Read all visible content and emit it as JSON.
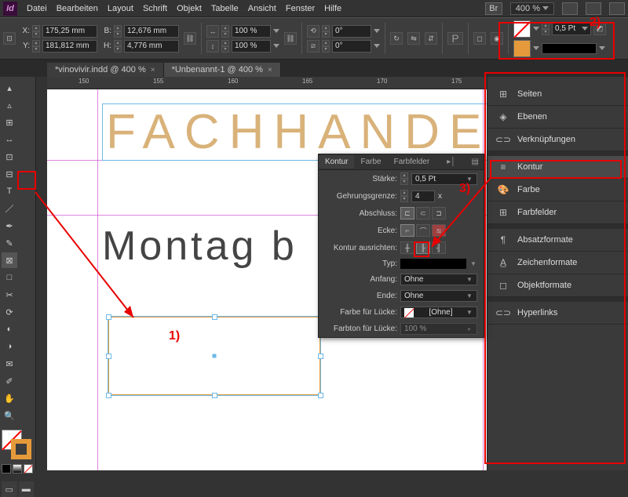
{
  "app": {
    "logo": "Id"
  },
  "menu": [
    "Datei",
    "Bearbeiten",
    "Layout",
    "Schrift",
    "Objekt",
    "Tabelle",
    "Ansicht",
    "Fenster",
    "Hilfe"
  ],
  "menu_right": {
    "br": "Br",
    "zoom": "400 %"
  },
  "control": {
    "x": "175,25 mm",
    "y": "181,812 mm",
    "w": "12,676 mm",
    "h": "4,776 mm",
    "sx": "100 %",
    "sy": "100 %",
    "rot": "0°",
    "shear": "0°",
    "stroke_weight": "0,5 Pt"
  },
  "tabs": [
    {
      "label": "*vinovivir.indd @ 400 %",
      "active": false
    },
    {
      "label": "*Unbenannt-1 @ 400 %",
      "active": true
    }
  ],
  "ruler_marks": [
    "150",
    "155",
    "160",
    "165",
    "170",
    "175"
  ],
  "canvas": {
    "heading": "FACHHANDE",
    "subheading": "Montag b"
  },
  "panels": {
    "items": [
      {
        "icon": "⊞",
        "label": "Seiten"
      },
      {
        "icon": "◈",
        "label": "Ebenen"
      },
      {
        "icon": "⊂⊃",
        "label": "Verknüpfungen"
      }
    ],
    "items2": [
      {
        "icon": "≡",
        "label": "Kontur",
        "active": true
      },
      {
        "icon": "🎨",
        "label": "Farbe"
      },
      {
        "icon": "⊞",
        "label": "Farbfelder"
      }
    ],
    "items3": [
      {
        "icon": "¶",
        "label": "Absatzformate"
      },
      {
        "icon": "A̲",
        "label": "Zeichenformate"
      },
      {
        "icon": "◻",
        "label": "Objektformate"
      }
    ],
    "items4": [
      {
        "icon": "⊂⊃",
        "label": "Hyperlinks"
      }
    ]
  },
  "stroke_panel": {
    "tabs": [
      "Kontur",
      "Farbe",
      "Farbfelder"
    ],
    "rows": {
      "staerke": {
        "label": "Stärke:",
        "value": "0,5 Pt"
      },
      "gehrung": {
        "label": "Gehrungsgrenze:",
        "value": "4",
        "suffix": "x"
      },
      "abschluss": {
        "label": "Abschluss:"
      },
      "ecke": {
        "label": "Ecke:"
      },
      "ausrichten": {
        "label": "Kontur ausrichten:"
      },
      "typ": {
        "label": "Typ:"
      },
      "anfang": {
        "label": "Anfang:",
        "value": "Ohne"
      },
      "ende": {
        "label": "Ende:",
        "value": "Ohne"
      },
      "farbe_luecke": {
        "label": "Farbe für Lücke:",
        "value": "[Ohne]"
      },
      "farbton_luecke": {
        "label": "Farbton für Lücke:",
        "value": "100 %"
      }
    }
  },
  "annotations": {
    "a1": "1)",
    "a2": "2)",
    "a3": "3)"
  }
}
